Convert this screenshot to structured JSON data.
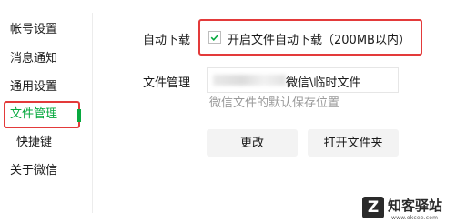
{
  "sidebar": {
    "items": [
      {
        "label": "帐号设置",
        "active": false
      },
      {
        "label": "消息通知",
        "active": false
      },
      {
        "label": "通用设置",
        "active": false
      },
      {
        "label": "文件管理",
        "active": true
      },
      {
        "label": "快捷键",
        "active": false
      },
      {
        "label": "关于微信",
        "active": false
      }
    ]
  },
  "settings": {
    "auto_download": {
      "label": "自动下载",
      "checkbox_text": "开启文件自动下载（200MB以内）",
      "checked": true
    },
    "file_management": {
      "label": "文件管理",
      "path_value": "微信\\临时文件",
      "hint": "微信文件的默认保存位置"
    },
    "buttons": {
      "change": "更改",
      "open_folder": "打开文件夹"
    }
  },
  "watermark": {
    "name": "知客驿站",
    "url": "www.okcee.com"
  },
  "colors": {
    "accent": "#07a93f",
    "highlight": "#e33a3a"
  }
}
